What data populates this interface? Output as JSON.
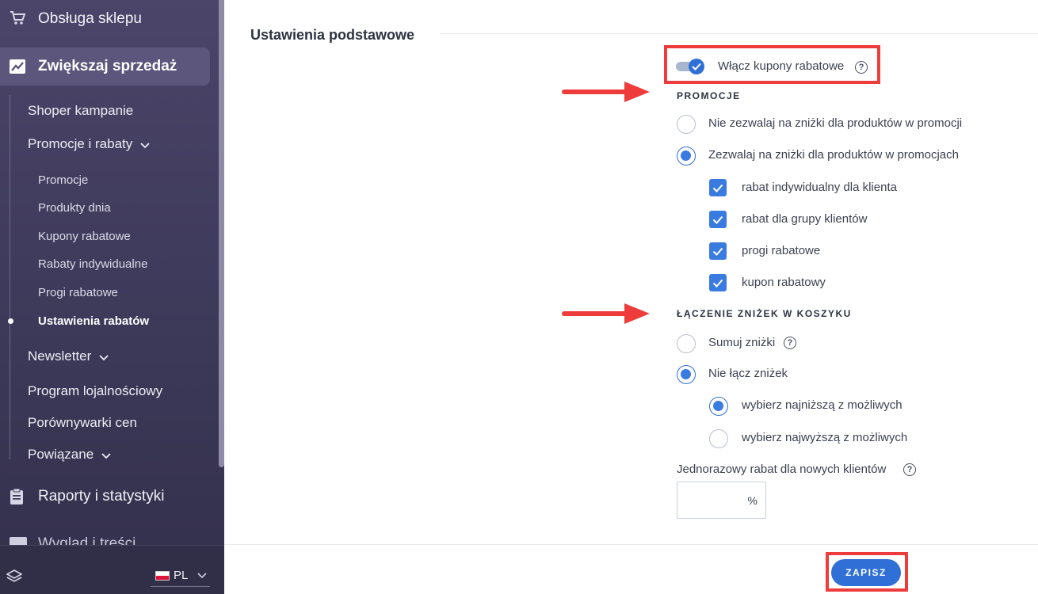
{
  "sidebar": {
    "top_item": "Obsługa sklepu",
    "active_item": "Zwiększaj sprzedaż",
    "items": [
      {
        "label": "Shoper kampanie"
      },
      {
        "label": "Promocje i rabaty"
      },
      {
        "label": "Newsletter"
      },
      {
        "label": "Program lojalnościowy"
      },
      {
        "label": "Porównywarki cen"
      },
      {
        "label": "Powiązane"
      }
    ],
    "promo_children": [
      {
        "label": "Promocje"
      },
      {
        "label": "Produkty dnia"
      },
      {
        "label": "Kupony rabatowe"
      },
      {
        "label": "Rabaty indywidualne"
      },
      {
        "label": "Progi rabatowe"
      },
      {
        "label": "Ustawienia rabatów",
        "active": true
      }
    ],
    "reports_item": "Raporty i statystyki",
    "cut_item": "Wygląd i treści",
    "language": "PL"
  },
  "main": {
    "section_title": "Ustawienia podstawowe",
    "coupons_toggle": {
      "label": "Włącz kupony rabatowe",
      "on": true
    },
    "promotions": {
      "heading": "PROMOCJE",
      "options": [
        {
          "label": "Nie zezwalaj na zniżki dla produktów w promocji",
          "selected": false
        },
        {
          "label": "Zezwalaj na zniżki dla produktów w promocjach",
          "selected": true
        }
      ],
      "checks": [
        {
          "label": "rabat indywidualny dla klienta",
          "checked": true
        },
        {
          "label": "rabat dla grupy klientów",
          "checked": true
        },
        {
          "label": "progi rabatowe",
          "checked": true
        },
        {
          "label": "kupon rabatowy",
          "checked": true
        }
      ]
    },
    "cart": {
      "heading": "ŁĄCZENIE ZNIŻEK W KOSZYKU",
      "options": [
        {
          "label": "Sumuj zniżki",
          "selected": false
        },
        {
          "label": "Nie łącz zniżek",
          "selected": true
        }
      ],
      "sub_options": [
        {
          "label": "wybierz najniższą z możliwych",
          "selected": true
        },
        {
          "label": "wybierz najwyższą z możliwych",
          "selected": false
        }
      ]
    },
    "new_client_discount": {
      "label": "Jednorazowy rabat dla nowych klientów",
      "value": "",
      "unit": "%"
    },
    "save_label": "ZAPISZ"
  },
  "colors": {
    "accent": "#2f6fd6",
    "annotation": "#ee3b3b",
    "sidebar": "#433e62"
  }
}
